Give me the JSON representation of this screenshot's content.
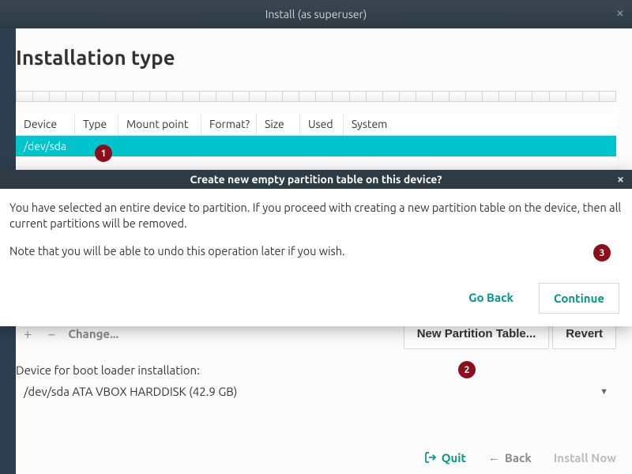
{
  "window": {
    "title": "Install (as superuser)"
  },
  "page": {
    "heading": "Installation type"
  },
  "table": {
    "headers": {
      "device": "Device",
      "type": "Type",
      "mount": "Mount point",
      "format": "Format?",
      "size": "Size",
      "used": "Used",
      "system": "System"
    },
    "rows": [
      {
        "device": "/dev/sda"
      }
    ]
  },
  "toolbar": {
    "change_label": "Change...",
    "new_partition_label": "New Partition Table...",
    "revert_label": "Revert"
  },
  "bootloader": {
    "label": "Device for boot loader installation:",
    "selected": "/dev/sda ATA VBOX HARDDISK (42.9 GB)"
  },
  "footer": {
    "quit": "Quit",
    "back": "Back",
    "install": "Install Now"
  },
  "dialog": {
    "title": "Create new empty partition table on this device?",
    "para1": "You have selected an entire device to partition. If you proceed with creating a new partition table on the device, then all current partitions will be removed.",
    "para2": "Note that you will be able to undo this operation later if you wish.",
    "go_back": "Go Back",
    "continue": "Continue"
  },
  "annotations": {
    "a1": "1",
    "a2": "2",
    "a3": "3"
  }
}
